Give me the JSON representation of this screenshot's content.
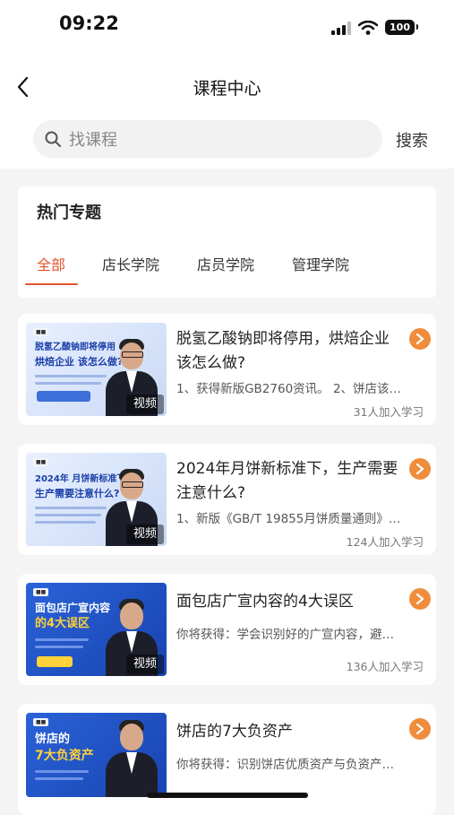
{
  "status_bar": {
    "time": "09:22",
    "battery": "100"
  },
  "header": {
    "title": "课程中心"
  },
  "search": {
    "placeholder": "找课程",
    "button_label": "搜索"
  },
  "hot_topics": {
    "title": "热门专题",
    "tabs": [
      {
        "label": "全部",
        "active": true
      },
      {
        "label": "店长学院",
        "active": false
      },
      {
        "label": "店员学院",
        "active": false
      },
      {
        "label": "管理学院",
        "active": false
      }
    ]
  },
  "courses": [
    {
      "title": "脱氢乙酸钠即将停用，烘焙企业该怎么做?",
      "desc": "1、获得新版GB2760资讯。 2、饼店该…",
      "count": "31人加入学习",
      "badge": "视频",
      "thumb_text_1": "脱氢乙酸钠即将停用",
      "thumb_text_2": "烘焙企业 该怎么做?"
    },
    {
      "title": "2024年月饼新标准下，生产需要注意什么?",
      "desc": "1、新版《GB/T 19855月饼质量通则》…",
      "count": "124人加入学习",
      "badge": "视频",
      "thumb_text_1": "2024年 月饼新标准下",
      "thumb_text_2": "生产需要注意什么?"
    },
    {
      "title": "面包店广宣内容的4大误区",
      "desc": "你将获得：学会识别好的广宣内容，避…",
      "count": "136人加入学习",
      "badge": "视频",
      "thumb_text_1": "面包店广宣内容",
      "thumb_text_2": "的4大误区"
    },
    {
      "title": "饼店的7大负资产",
      "desc": "你将获得：识别饼店优质资产与负资产…",
      "count": "",
      "badge": "",
      "thumb_text_1": "饼店的",
      "thumb_text_2": "7大负资产"
    }
  ],
  "colors": {
    "accent": "#e4532e",
    "arrow": "#f08d3c"
  }
}
